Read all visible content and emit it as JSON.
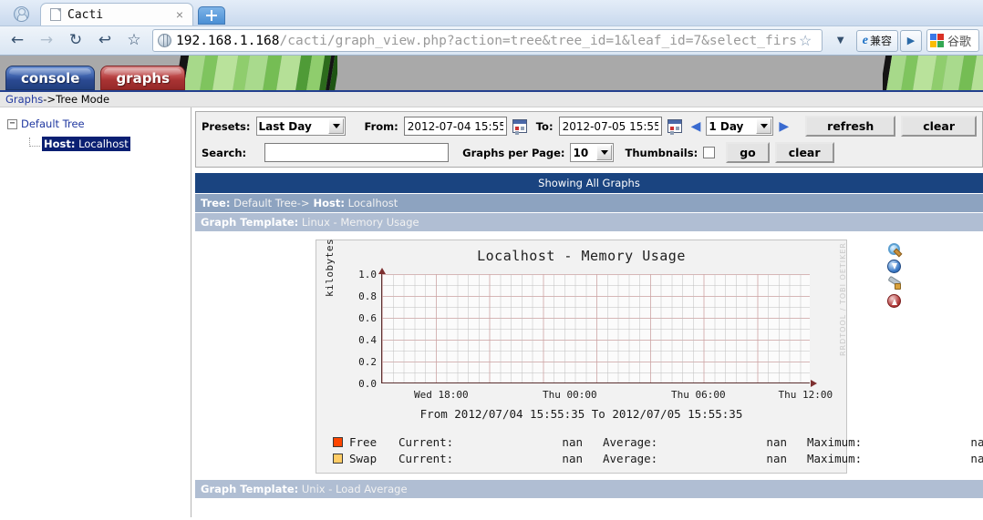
{
  "browser": {
    "tab_title": "Cacti",
    "tab_close": "×",
    "url_host": "192.168.1.168",
    "url_path": "/cacti/graph_view.php?action=tree&tree_id=1&leaf_id=7&select_firs",
    "back_icon": "←",
    "forward_icon": "→",
    "reload_icon": "↻",
    "home_icon": "↩",
    "bookmark_icon": "☆",
    "star_icon": "☆",
    "dropdown_icon": "▼",
    "ie_compat_label": "兼容",
    "play_icon": "▶",
    "google_label": "谷歌"
  },
  "cacti": {
    "tabs": [
      {
        "label": "console",
        "name": "console"
      },
      {
        "label": "graphs",
        "name": "graphs"
      }
    ],
    "breadcrumb": {
      "link": "Graphs",
      "separator": " -> ",
      "current": "Tree Mode"
    }
  },
  "sidebar": {
    "root": {
      "expander": "−",
      "label": "Default Tree"
    },
    "child": {
      "prefix": "Host:",
      "label": " Localhost"
    }
  },
  "filters": {
    "presets_label": "Presets:",
    "presets_value": "Last Day",
    "from_label": "From:",
    "from_value": "2012-07-04 15:55",
    "to_label": "To:",
    "to_value": "2012-07-05 15:55",
    "span_value": "1 Day",
    "prev_arrow": "◀",
    "next_arrow": "▶",
    "refresh_label": "refresh",
    "clear_label": "clear",
    "search_label": "Search:",
    "search_value": "",
    "search_placeholder": "",
    "graphs_per_page_label": "Graphs per Page:",
    "graphs_per_page_value": "10",
    "thumbnails_label": "Thumbnails:",
    "go_label": "go",
    "clear2_label": "clear"
  },
  "headers": {
    "showing": "Showing All Graphs",
    "tree_key": "Tree:",
    "tree_value": " Default Tree->",
    "host_key": " Host:",
    "host_value": " Localhost",
    "template_key": "Graph Template:",
    "template_value": " Linux - Memory Usage",
    "template_key2": "Graph Template:",
    "template_value2": " Unix - Load Average"
  },
  "graph_actions": [
    {
      "name": "zoom-graph-icon"
    },
    {
      "name": "download-graph-icon"
    },
    {
      "name": "graph-properties-icon"
    },
    {
      "name": "page-top-icon"
    }
  ],
  "watermark": "RRDTOOL / TOBI OETIKER",
  "chart_data": {
    "type": "line",
    "title": "Localhost - Memory Usage",
    "xlabel": "",
    "ylabel": "kilobytes",
    "ylim": [
      0.0,
      1.0
    ],
    "yticks": [
      "1.0",
      "0.8",
      "0.6",
      "0.4",
      "0.2",
      "0.0"
    ],
    "xticks": [
      "Wed 18:00",
      "Thu 00:00",
      "Thu 06:00",
      "Thu 12:00"
    ],
    "xtick_positions": [
      14,
      44,
      74,
      96
    ],
    "range_text": "From 2012/07/04 15:55:35 To 2012/07/05 15:55:35",
    "grid": true,
    "legend_position": "below",
    "legend_columns": [
      "Current:",
      "Average:",
      "Maximum:"
    ],
    "series": [
      {
        "name": "Free",
        "color": "#FF4500",
        "values": [],
        "current": "nan",
        "average": "nan",
        "maximum": "nan",
        "current_label": "Current:",
        "average_label": "Average:",
        "maximum_label": "Maximum:"
      },
      {
        "name": "Swap",
        "color": "#FFCC66",
        "values": [],
        "current": "nan",
        "average": "nan",
        "maximum": "nan",
        "current_label": "Current:",
        "average_label": "Average:",
        "maximum_label": "Maximum:"
      }
    ]
  }
}
